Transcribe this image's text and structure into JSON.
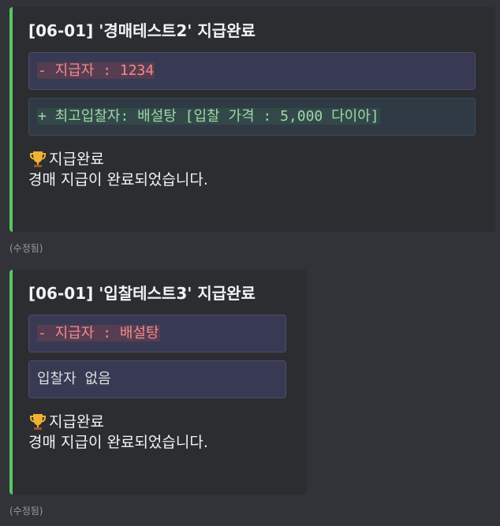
{
  "messages": [
    {
      "title": "[06-01] '경매테스트2' 지급완료",
      "blocks": [
        {
          "kind": "minus",
          "text": "- 지급자 : 1234"
        },
        {
          "kind": "plus",
          "text": "+ 최고입찰자: 배설탕 [입찰 가격 : 5,000 다이아]"
        }
      ],
      "status_label": "지급완료",
      "status_icon": "trophy-icon",
      "description": "경매 지급이 완료되었습니다.",
      "edited": "(수정됨)"
    },
    {
      "title": "[06-01] '입찰테스트3' 지급완료",
      "blocks": [
        {
          "kind": "minus",
          "text": "- 지급자 : 배설탕"
        },
        {
          "kind": "plain",
          "text": "입찰자 없음"
        }
      ],
      "status_label": "지급완료",
      "status_icon": "trophy-icon",
      "description": "경매 지급이 완료되었습니다.",
      "edited": "(수정됨)"
    }
  ],
  "colors": {
    "background": "#313338",
    "embed_background": "#2b2d31",
    "embed_accent": "#57c764",
    "diff_minus": "#f38b8b",
    "diff_plus": "#9fd8a7"
  }
}
